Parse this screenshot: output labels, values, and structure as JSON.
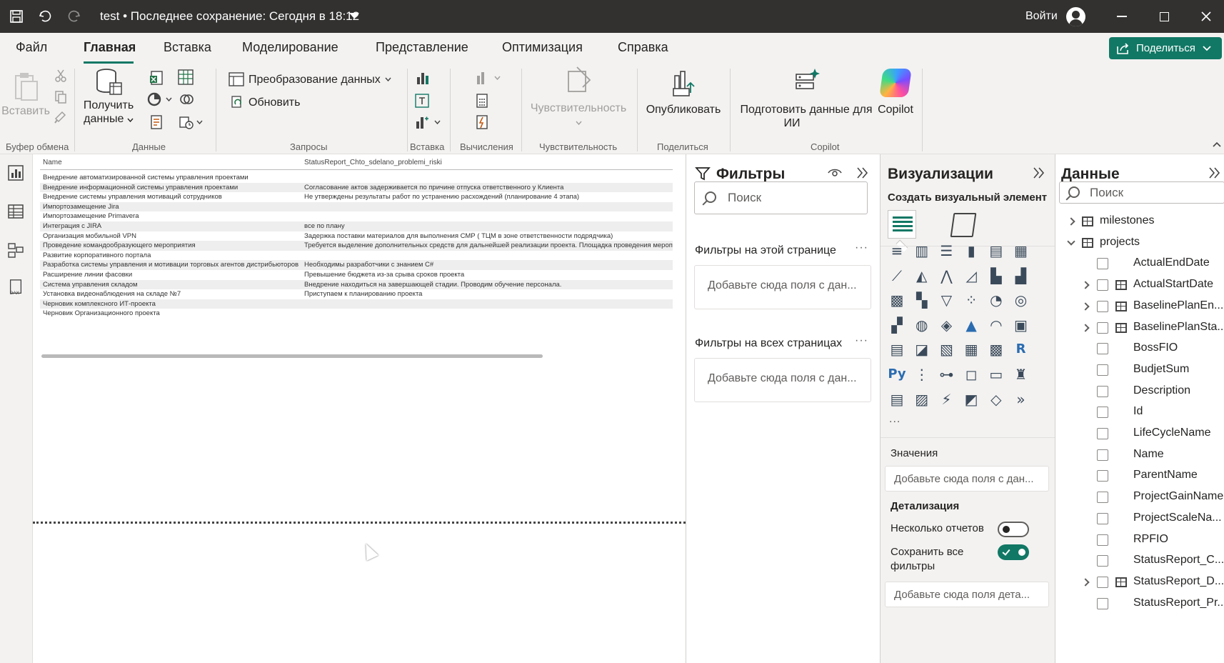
{
  "titlebar": {
    "title": "test • Последнее сохранение: Сегодня в 18:12",
    "signin": "Войти",
    "icons": [
      "save-icon",
      "undo-icon",
      "redo-icon",
      "user-avatar-icon",
      "minimize-icon",
      "maximize-icon",
      "close-icon"
    ]
  },
  "menu": {
    "tabs": [
      "Файл",
      "Главная",
      "Вставка",
      "Моделирование",
      "Представление",
      "Оптимизация",
      "Справка"
    ],
    "active": "Главная",
    "share_label": "Поделиться"
  },
  "ribbon": {
    "paste": "Вставить",
    "get_data": "Получить данные",
    "get_data_line1": "Получить",
    "get_data_line2": "данные",
    "transform": "Преобразование данных",
    "refresh": "Обновить",
    "sensitivity": "Чувствительность",
    "publish": "Опубликовать",
    "prepare_ai": "Подготовить данные для ИИ",
    "prepare_ai_line1": "Подготовить данные для",
    "prepare_ai_line2": "ИИ",
    "copilot": "Copilot",
    "groups": {
      "clipboard": "Буфер обмена",
      "data": "Данные",
      "queries": "Запросы",
      "insert": "Вставка",
      "calc": "Вычисления",
      "sensitivity": "Чувствительность",
      "share": "Поделиться",
      "copilot": "Copilot"
    }
  },
  "table": {
    "headers": [
      "Name",
      "StatusReport_Chto_sdelano_problemi_riski"
    ],
    "rows": [
      [
        "Внедрение автоматизированной системы управления проектами",
        ""
      ],
      [
        "Внедрение информационной системы управления проектами",
        "Согласование актов задерживается по причине отпуска ответственного у Клиента"
      ],
      [
        "Внедрение системы управления мотиваций сотрудников",
        "Не утверждены результаты работ по устранению расхождений (планирование 4 этапа)"
      ],
      [
        "Импортозамещение Jira",
        ""
      ],
      [
        "Импортозамещение Primavera",
        ""
      ],
      [
        "Интеграция с JIRA",
        "все по плану"
      ],
      [
        "Организация мобильной VPN",
        "Задержка поставки материалов для выполнения СМР ( ТЦМ в зоне ответственности подрядчика)"
      ],
      [
        "Проведение командообразующего мероприятия",
        "Требуется выделение дополнительных средств для дальнейшей реализации проекта. Площадка проведения мероп"
      ],
      [
        "Развитие корпоративного портала",
        ""
      ],
      [
        "Разработка системы управления и мотивации торговых агентов дистрибьюторов",
        "Необходимы разработчики с знанием C#"
      ],
      [
        "Расширение линии фасовки",
        "Превышение бюджета из-за срыва сроков проекта"
      ],
      [
        "Система управления складом",
        "Внедрение находиться на завершающей стадии. Проводим обучение персонала."
      ],
      [
        "Установка видеонаблюдения на складе №7",
        "Приступаем к планированию проекта"
      ],
      [
        "Черновик комплексного ИТ-проекта",
        ""
      ],
      [
        "Черновик Организационного проекта",
        ""
      ]
    ]
  },
  "filters": {
    "title": "Фильтры",
    "search_placeholder": "Поиск",
    "page_filters": "Фильтры на этой странице",
    "all_filters": "Фильтры на всех страницах",
    "drop_hint": "Добавьте сюда поля с дан..."
  },
  "viz": {
    "title": "Визуализации",
    "subtitle": "Создать визуальный элемент",
    "values_label": "Значения",
    "values_hint": "Добавьте сюда поля с дан...",
    "drill_label": "Детализация",
    "multi_reports": "Несколько отчетов",
    "keep_filters_line1": "Сохранить все",
    "keep_filters_line2": "фильтры",
    "drill_hint": "Добавьте сюда поля дета...",
    "more": "..."
  },
  "data": {
    "title": "Данные",
    "search_placeholder": "Поиск",
    "tables": [
      {
        "name": "milestones",
        "expanded": false
      },
      {
        "name": "projects",
        "expanded": true
      }
    ],
    "fields": [
      {
        "name": "ActualEndDate",
        "hier": false
      },
      {
        "name": "ActualStartDate",
        "hier": true
      },
      {
        "name": "BaselinePlanEn...",
        "hier": true
      },
      {
        "name": "BaselinePlanSta...",
        "hier": true
      },
      {
        "name": "BossFIO",
        "hier": false
      },
      {
        "name": "BudjetSum",
        "hier": false
      },
      {
        "name": "Description",
        "hier": false
      },
      {
        "name": "Id",
        "hier": false
      },
      {
        "name": "LifeCycleName",
        "hier": false
      },
      {
        "name": "Name",
        "hier": false
      },
      {
        "name": "ParentName",
        "hier": false
      },
      {
        "name": "ProjectGainName",
        "hier": false
      },
      {
        "name": "ProjectScaleNa...",
        "hier": false
      },
      {
        "name": "RPFIO",
        "hier": false
      },
      {
        "name": "StatusReport_C...",
        "hier": false
      },
      {
        "name": "StatusReport_D...",
        "hier": true
      },
      {
        "name": "StatusReport_Pr...",
        "hier": false
      }
    ]
  },
  "colors": {
    "accent": "#117865",
    "titlebar": "#323130",
    "ribbon": "#f3f2f1"
  }
}
